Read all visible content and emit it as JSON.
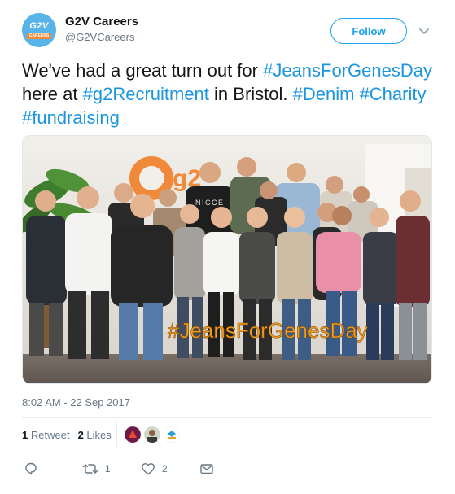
{
  "author": {
    "display_name": "G2V Careers",
    "handle": "@G2VCareers",
    "avatar": {
      "text": "G2V",
      "ribbon": "CAREERS",
      "color": "#58b3e8",
      "ribbon_color": "#f08a3a"
    }
  },
  "follow_button": {
    "label": "Follow",
    "color": "#1da1f2"
  },
  "tweet": {
    "segments": [
      {
        "text": "We've had a great turn out for ",
        "hashtag": false
      },
      {
        "text": "#JeansForGenesDay",
        "hashtag": true
      },
      {
        "text": " here at ",
        "hashtag": false
      },
      {
        "text": "#g2Recruitment",
        "hashtag": true
      },
      {
        "text": " in Bristol.  ",
        "hashtag": false
      },
      {
        "text": "#Denim",
        "hashtag": true
      },
      {
        "text": " ",
        "hashtag": false
      },
      {
        "text": "#Charity",
        "hashtag": true
      },
      {
        "text": " ",
        "hashtag": false
      },
      {
        "text": "#fundraising",
        "hashtag": true
      }
    ],
    "hashtag_color": "#1b95e0"
  },
  "photo": {
    "overlay_text": "#JeansForGenesDay",
    "wall_logo": "g2",
    "shirt_text": "NICCE"
  },
  "timestamp": "8:02 AM - 22 Sep 2017",
  "stats": {
    "retweets_count": "1",
    "retweets_label": "Retweet",
    "likes_count": "2",
    "likes_label": "Likes"
  },
  "actions": {
    "reply_icon": "reply-icon",
    "retweet_icon": "retweet-icon",
    "retweet_count": "1",
    "like_icon": "heart-icon",
    "like_count": "2",
    "message_icon": "envelope-icon"
  }
}
